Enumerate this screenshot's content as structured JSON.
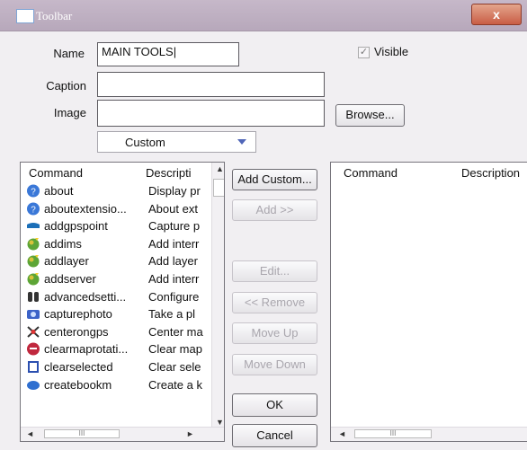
{
  "window": {
    "title": "Toolbar",
    "close_glyph": "x"
  },
  "form": {
    "name_label": "Name",
    "name_value": "MAIN TOOLS",
    "caption_label": "Caption",
    "caption_value": "",
    "image_label": "Image",
    "image_value": "",
    "visible_label": "Visible",
    "visible_checked": true,
    "browse_label": "Browse...",
    "category_selected": "Custom"
  },
  "left_list": {
    "col_command": "Command",
    "col_description": "Descripti",
    "items": [
      {
        "command": "about",
        "description": "Display pr",
        "icon": "info-icon"
      },
      {
        "command": "aboutextensio...",
        "description": "About ext",
        "icon": "info-icon"
      },
      {
        "command": "addgpspoint",
        "description": "Capture p",
        "icon": "gps-icon"
      },
      {
        "command": "addims",
        "description": "Add interr",
        "icon": "globe-add-icon"
      },
      {
        "command": "addlayer",
        "description": "Add layer",
        "icon": "globe-add-icon"
      },
      {
        "command": "addserver",
        "description": "Add interr",
        "icon": "globe-add-icon"
      },
      {
        "command": "advancedsetti...",
        "description": "Configure",
        "icon": "binoculars-icon"
      },
      {
        "command": "capturephoto",
        "description": "Take a pl",
        "icon": "camera-icon"
      },
      {
        "command": "centerongps",
        "description": "Center ma",
        "icon": "center-icon"
      },
      {
        "command": "clearmaprotati...",
        "description": "Clear map",
        "icon": "clear-map-icon"
      },
      {
        "command": "clearselected",
        "description": "Clear sele",
        "icon": "clear-selection-icon"
      },
      {
        "command": "createbookm",
        "description": "Create a k",
        "icon": "bookmark-icon"
      }
    ]
  },
  "buttons": {
    "add_custom": "Add Custom...",
    "add": "Add >>",
    "edit": "Edit...",
    "remove": "<< Remove",
    "move_up": "Move Up",
    "move_down": "Move Down",
    "ok": "OK",
    "cancel": "Cancel"
  },
  "right_list": {
    "col_command": "Command",
    "col_description": "Description",
    "items": []
  },
  "scroll": {
    "thumb_glyph": "III"
  },
  "colors": {
    "titlebar": "#bcaec0",
    "close": "#d0644b",
    "info": "#3a78d8",
    "globe": "#5da536"
  }
}
